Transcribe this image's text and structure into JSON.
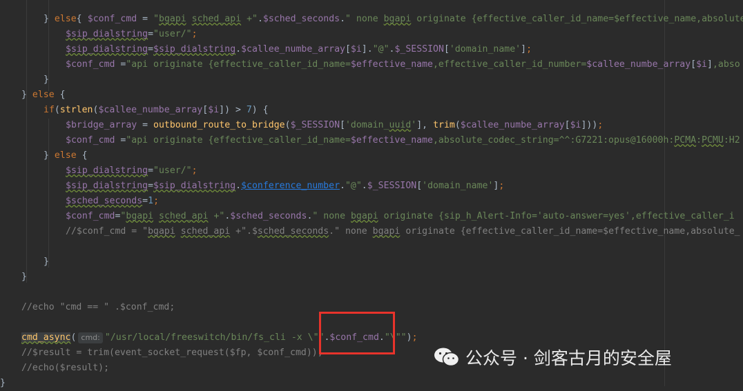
{
  "code_lines": [
    "$conf_cmd = \"bgapi sched_api +\".$sched_seconds.\" none bgapi originate {effective_caller_id_name=$effective_name,absolute_co",
    "} else{",
    "$sip_dialstring=\"user/\";",
    "$sip_dialstring=$sip_dialstring.$callee_numbe_array[$i].\"@\".$_SESSION['domain_name'];",
    "$conf_cmd =\"api originate {effective_caller_id_name=$effective_name,effective_caller_id_number=$callee_numbe_array[$i],abso",
    "}",
    "} else {",
    "if(strlen($callee_numbe_array[$i]) > 7) {",
    "$bridge_array = outbound_route_to_bridge($_SESSION['domain_uuid'], trim($callee_numbe_array[$i]));",
    "$conf_cmd =\"api originate {effective_caller_id_name=$effective_name,absolute_codec_string=^^:G7221:opus@16000h:PCMA:PCMU:H2",
    "} else {",
    "$sip_dialstring=\"user/\";",
    "$sip_dialstring=$sip_dialstring.$conference_number.\"@\".$_SESSION['domain_name'];",
    "$sched_seconds=1;",
    "$conf_cmd=\"bgapi sched_api +\".$sched_seconds.\" none bgapi originate {sip_h_Alert-Info='auto-answer=yes',effective_caller_i",
    "//$conf_cmd = \"bgapi sched_api +\".$sched_seconds.\" none bgapi originate {effective_caller_id_name=$effective_name,absolute_",
    "}",
    "}",
    "//echo \"cmd == \" .$conf_cmd;",
    "cmd_async( cmd: \"/usr/local/freeswitch/bin/fs_cli -x \\\"\".$conf_cmd.\"\\\"\");",
    "//$result = trim(event_socket_request($fp, $conf_cmd));",
    "//echo($result);",
    "}"
  ],
  "param_hint": "cmd:",
  "watermark": {
    "text": "公众号 · 剑客古月的安全屋",
    "icon": "wechat-icon"
  },
  "colors": {
    "background": "#2b2b2b",
    "variable": "#9876aa",
    "string": "#6a8759",
    "keyword": "#cc7832",
    "function": "#ffc66d",
    "comment": "#808080",
    "text": "#a9b7c6",
    "link": "#287bde",
    "highlight_box": "#e8332b"
  }
}
